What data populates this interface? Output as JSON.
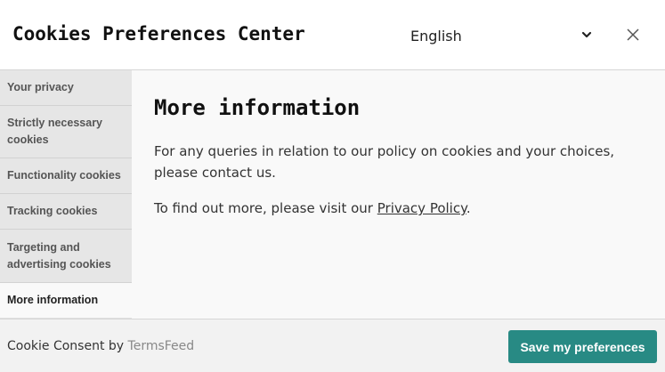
{
  "header": {
    "title": "Cookies Preferences Center",
    "language": "English"
  },
  "sidebar": {
    "items": [
      {
        "label": "Your privacy"
      },
      {
        "label": "Strictly necessary cookies"
      },
      {
        "label": "Functionality cookies"
      },
      {
        "label": "Tracking cookies"
      },
      {
        "label": "Targeting and advertising cookies"
      },
      {
        "label": "More information",
        "active": true
      }
    ]
  },
  "main": {
    "heading": "More information",
    "paragraph1": "For any queries in relation to our policy on cookies and your choices, please contact us.",
    "paragraph2_prefix": "To find out more, please visit our ",
    "paragraph2_link": "Privacy Policy",
    "paragraph2_suffix": "."
  },
  "footer": {
    "consent_prefix": "Cookie Consent by ",
    "consent_link": "TermsFeed",
    "save_label": "Save my preferences"
  },
  "colors": {
    "accent": "#288a84",
    "sidebar_bg": "#e6e6e6",
    "content_bg": "#f9f9f9"
  },
  "icons": {
    "language_dropdown": "chevron-down-icon",
    "close": "close-icon"
  }
}
